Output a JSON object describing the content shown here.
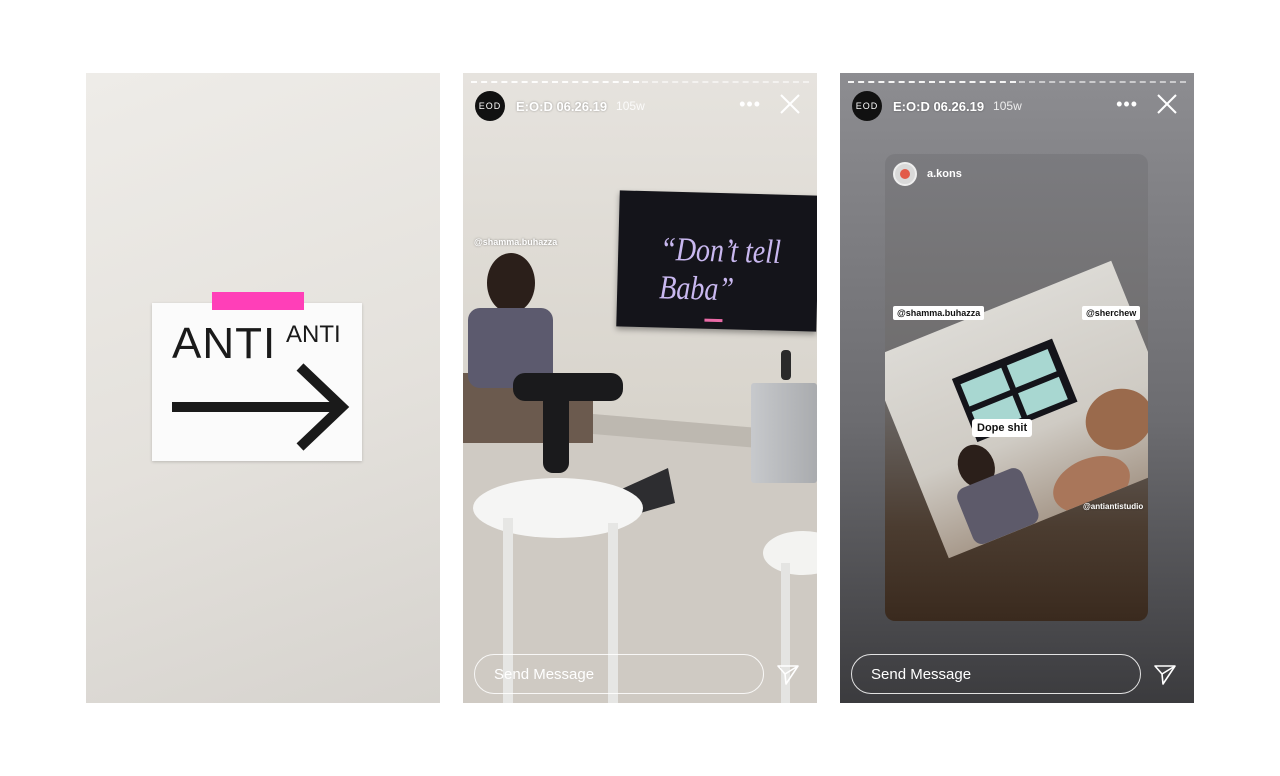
{
  "panel1": {
    "sign_big": "ANTI",
    "sign_small": "ANTI"
  },
  "story": {
    "account": "E:O:D 06.26.19",
    "avatar_text": "EOD",
    "age": "105w",
    "more_label": "•••",
    "message_placeholder": "Send Message"
  },
  "panel2": {
    "tv_text": "“Don’t tell Baba”",
    "mention": "@shamma.buhazza"
  },
  "panel3": {
    "repost_user": "a.kons",
    "tags": [
      "@shamma.buhazza",
      "@sherchew"
    ],
    "sticker": "Dope shit",
    "studio_tag": "@antiantistudio"
  },
  "colors": {
    "tape": "#ff3fb8",
    "tv_text": "#c9b8f0"
  }
}
